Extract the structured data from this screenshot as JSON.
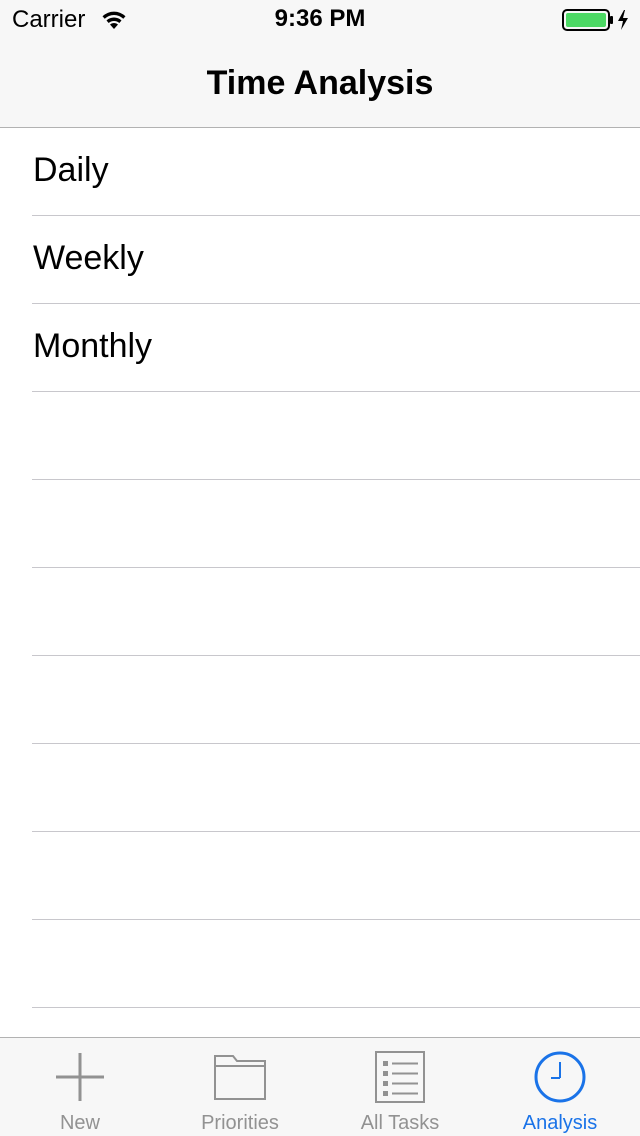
{
  "status_bar": {
    "carrier": "Carrier",
    "time": "9:36 PM",
    "wifi_icon": "wifi-icon",
    "battery_icon": "battery-charging-icon",
    "battery_color": "#4cd964"
  },
  "nav": {
    "title": "Time Analysis"
  },
  "list": {
    "rows": [
      {
        "label": "Daily"
      },
      {
        "label": "Weekly"
      },
      {
        "label": "Monthly"
      },
      {
        "label": ""
      },
      {
        "label": ""
      },
      {
        "label": ""
      },
      {
        "label": ""
      },
      {
        "label": ""
      },
      {
        "label": ""
      },
      {
        "label": ""
      },
      {
        "label": ""
      }
    ]
  },
  "tab_bar": {
    "active_color": "#1a73e8",
    "inactive_color": "#929292",
    "tabs": [
      {
        "label": "New",
        "icon": "plus-icon",
        "active": false
      },
      {
        "label": "Priorities",
        "icon": "folder-icon",
        "active": false
      },
      {
        "label": "All Tasks",
        "icon": "list-icon",
        "active": false
      },
      {
        "label": "Analysis",
        "icon": "clock-icon",
        "active": true
      }
    ]
  }
}
